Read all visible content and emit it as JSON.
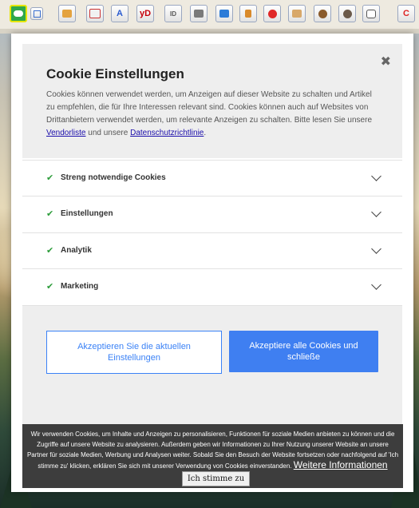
{
  "dialog": {
    "title": "Cookie Einstellungen",
    "close_label": "✖",
    "description_part1": "Cookies können verwendet werden, um Anzeigen auf dieser Website zu schalten und Artikel zu empfehlen, die für Ihre Interessen relevant sind. Cookies können auch auf Websites von Drittanbietern verwendet werden, um relevante Anzeigen zu schalten. Bitte lesen Sie unsere ",
    "vendor_link": "Vendorliste",
    "description_part2": " und unsere ",
    "privacy_link": "Datenschutzrichtlinie",
    "description_part3": ".",
    "categories": [
      {
        "check": "✔",
        "label": "Streng notwendige Cookies"
      },
      {
        "check": "✔",
        "label": "Einstellungen"
      },
      {
        "check": "✔",
        "label": "Analytik"
      },
      {
        "check": "✔",
        "label": "Marketing"
      }
    ],
    "accept_current_label": "Akzeptieren Sie die aktuellen Einstellungen",
    "accept_all_label": "Akzeptiere alle Cookies und schließe"
  },
  "banner": {
    "text": "Wir verwenden Cookies, um Inhalte und Anzeigen zu personalisieren, Funktionen für soziale Medien anbieten zu können und die Zugriffe auf unsere Website zu analysieren. Außerdem geben wir Informationen zu Ihrer Nutzung unserer Website an unsere Partner für soziale Medien, Werbung und Analysen weiter. Sobald Sie den Besuch der Website fortsetzen oder nachfolgend auf 'Ich stimme zu' klicken, erklären Sie sich mit unserer Verwendung von Cookies einverstanden.",
    "more_info_link": "Weitere Informationen",
    "agree_button": "Ich stimme zu"
  },
  "toolbar": {
    "icons": [
      "cloud-icon",
      "grid-icon",
      "broom-icon",
      "chat-icon",
      "translate-icon",
      "yandex-icon",
      "id-icon",
      "shoe-icon",
      "folder-icon",
      "tools-icon",
      "record-icon",
      "printer-icon",
      "cookie-icon",
      "monkey-icon",
      "pocket-icon",
      "reload-icon"
    ],
    "labels": {
      "translate": "A",
      "yandex": "yD",
      "id": "ID",
      "reload": "C"
    },
    "colors": {
      "accent": "#3f7ff1",
      "check": "#2c9c3a",
      "banner_bg": "#3d3d3d"
    }
  }
}
